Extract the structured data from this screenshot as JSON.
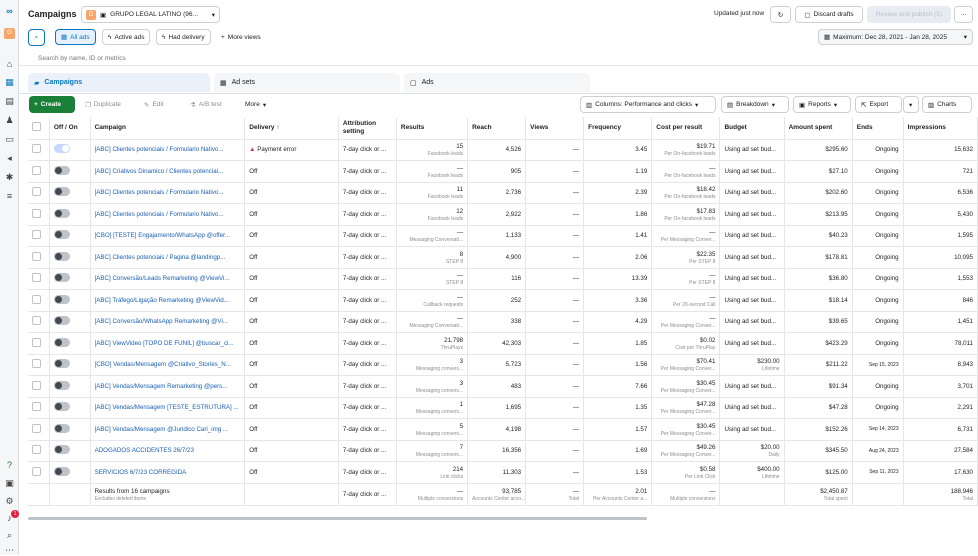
{
  "nav_rail": {
    "icons": [
      "meta-logo-icon",
      "account-avatar-icon",
      "home-icon",
      "table-icon",
      "pages-icon",
      "audiences-icon",
      "billing-icon",
      "megaphone-icon",
      "events-icon",
      "menu-icon",
      "help-icon",
      "notifications-icon",
      "settings-icon",
      "search-icon",
      "more-icon"
    ],
    "notification_badge": "1",
    "avatar_letter": "G"
  },
  "header": {
    "title": "Campaigns",
    "account_name": "GRUPO LEGAL LATINO (96...",
    "account_initial": "G",
    "updated": "Updated just now",
    "discard_label": "Discard drafts",
    "review_label": "Review and publish (5)",
    "more_label": "···"
  },
  "filters": {
    "all_ads": "All ads",
    "active_ads": "Active ads",
    "had_delivery": "Had delivery",
    "more_views": "More views",
    "date_range": "Maximum: Dec 28, 2021 - Jan 28, 2025",
    "search_placeholder": "Search by name, ID or metrics"
  },
  "tabs": {
    "campaigns": "Campaigns",
    "ad_sets": "Ad sets",
    "ads": "Ads"
  },
  "toolbar": {
    "create": "Create",
    "duplicate": "Duplicate",
    "edit": "Edit",
    "ab_test": "A/B test",
    "more": "More",
    "columns": "Columns: Performance and clicks",
    "breakdown": "Breakdown",
    "reports": "Reports",
    "export": "Export",
    "charts": "Charts"
  },
  "columns": {
    "offon": "Off / On",
    "campaign": "Campaign",
    "delivery": "Delivery ↑",
    "attribution": "Attribution setting",
    "results": "Results",
    "reach": "Reach",
    "views": "Views",
    "frequency": "Frequency",
    "cpr": "Cost per result",
    "budget": "Budget",
    "spent": "Amount spent",
    "ends": "Ends",
    "impressions": "Impressions"
  },
  "rows": [
    {
      "name": "[ABC] Clientes potenciais / Formulario Nativo...",
      "delivery": "Payment error",
      "error": true,
      "on": true,
      "attr": "7-day click or ...",
      "res": "15",
      "res_sub": "Facebook leads",
      "reach": "4,526",
      "views": "—",
      "freq": "3.45",
      "cpr": "$19.71",
      "cpr_sub": "Per On-facebook leads",
      "budget": "Using ad set bud...",
      "spent": "$295.60",
      "spent_sub": "",
      "ends": "Ongoing",
      "impr": "15,632"
    },
    {
      "name": "[ABC] Criativos Dinamico / Clientes potenciai...",
      "delivery": "Off",
      "error": false,
      "on": false,
      "attr": "7-day click or ...",
      "res": "—",
      "res_sub": "Facebook leads",
      "reach": "905",
      "views": "—",
      "freq": "1.19",
      "cpr": "—",
      "cpr_sub": "Per On-facebook leads",
      "budget": "Using ad set bud...",
      "spent": "$27.10",
      "spent_sub": "",
      "ends": "Ongoing",
      "impr": "721"
    },
    {
      "name": "[ABC] Clientes potenciais / Formulario Nativo...",
      "delivery": "Off",
      "error": false,
      "on": false,
      "attr": "7-day click or ...",
      "res": "11",
      "res_sub": "Facebook leads",
      "reach": "2,736",
      "views": "—",
      "freq": "2.39",
      "cpr": "$18.42",
      "cpr_sub": "Per On-facebook leads",
      "budget": "Using ad set bud...",
      "spent": "$202.60",
      "spent_sub": "",
      "ends": "Ongoing",
      "impr": "6,536"
    },
    {
      "name": "[ABC] Clientes potenciais / Formulario Nativo...",
      "delivery": "Off",
      "error": false,
      "on": false,
      "attr": "7-day click or ...",
      "res": "12",
      "res_sub": "Facebook leads",
      "reach": "2,922",
      "views": "—",
      "freq": "1.86",
      "cpr": "$17.83",
      "cpr_sub": "Per On-facebook leads",
      "budget": "Using ad set bud...",
      "spent": "$213.95",
      "spent_sub": "",
      "ends": "Ongoing",
      "impr": "5,430"
    },
    {
      "name": "[CBO] [TESTE] Engajamento/WhatsApp @offer...",
      "delivery": "Off",
      "error": false,
      "on": false,
      "attr": "7-day click or ...",
      "res": "—",
      "res_sub": "Messaging Conversati...",
      "reach": "1,133",
      "views": "—",
      "freq": "1.41",
      "cpr": "—",
      "cpr_sub": "Per Messaging Conver...",
      "budget": "Using ad set bud...",
      "spent": "$40.23",
      "spent_sub": "",
      "ends": "Ongoing",
      "impr": "1,595"
    },
    {
      "name": "[ABC] Clientes potenciais / Pagina @landingp...",
      "delivery": "Off",
      "error": false,
      "on": false,
      "attr": "7-day click or ...",
      "res": "8",
      "res_sub": "STEP 8",
      "reach": "4,900",
      "views": "—",
      "freq": "2.06",
      "cpr": "$22.35",
      "cpr_sub": "Per STEP 8",
      "budget": "Using ad set bud...",
      "spent": "$178.81",
      "spent_sub": "",
      "ends": "Ongoing",
      "impr": "10,095"
    },
    {
      "name": "[ABC] Conversão/Leads Remarketing @ViewVi...",
      "delivery": "Off",
      "error": false,
      "on": false,
      "attr": "7-day click or ...",
      "res": "—",
      "res_sub": "STEP 8",
      "reach": "116",
      "views": "—",
      "freq": "13.39",
      "cpr": "—",
      "cpr_sub": "Per STEP 8",
      "budget": "Using ad set bud...",
      "spent": "$36.80",
      "spent_sub": "",
      "ends": "Ongoing",
      "impr": "1,553"
    },
    {
      "name": "[ABC] Tráfego/Ligação Remarketing @ViewVid...",
      "delivery": "Off",
      "error": false,
      "on": false,
      "attr": "7-day click or ...",
      "res": "—",
      "res_sub": "Callback requests",
      "reach": "252",
      "views": "—",
      "freq": "3.36",
      "cpr": "—",
      "cpr_sub": "Per 20-second Call",
      "budget": "Using ad set bud...",
      "spent": "$18.14",
      "spent_sub": "",
      "ends": "Ongoing",
      "impr": "846"
    },
    {
      "name": "[ABC] Conversão/WhatsApp Remarketing @Vi...",
      "delivery": "Off",
      "error": false,
      "on": false,
      "attr": "7-day click or ...",
      "res": "—",
      "res_sub": "Messaging Conversati...",
      "reach": "338",
      "views": "—",
      "freq": "4.29",
      "cpr": "—",
      "cpr_sub": "Per Messaging Conver...",
      "budget": "Using ad set bud...",
      "spent": "$39.65",
      "spent_sub": "",
      "ends": "Ongoing",
      "impr": "1,451"
    },
    {
      "name": "[ABC] ViewVideo [TOPO DE FUNIL] @buscar_ci...",
      "delivery": "Off",
      "error": false,
      "on": false,
      "attr": "7-day click or ...",
      "res": "21,798",
      "res_sub": "ThruPlays",
      "reach": "42,303",
      "views": "—",
      "freq": "1.85",
      "cpr": "$0.02",
      "cpr_sub": "Cost per ThruPlay",
      "budget": "Using ad set bud...",
      "spent": "$423.29",
      "spent_sub": "",
      "ends": "Ongoing",
      "impr": "78,011"
    },
    {
      "name": "[CBO] Vendas/Mensagem @Criativo_Stories_N...",
      "delivery": "Off",
      "error": false,
      "on": false,
      "attr": "7-day click or ...",
      "res": "3",
      "res_sub": "Messaging convers...",
      "reach": "5,723",
      "views": "—",
      "freq": "1.56",
      "cpr": "$70.41",
      "cpr_sub": "Per Messaging Conver...",
      "budget": "$230.00",
      "budget_sub": "Lifetime",
      "spent": "$211.22",
      "spent_sub": "",
      "ends": "Sep 15, 2023",
      "impr": "8,943"
    },
    {
      "name": "[ABC] Vendas/Mensagem Remarketing @pers...",
      "delivery": "Off",
      "error": false,
      "on": false,
      "attr": "7-day click or ...",
      "res": "3",
      "res_sub": "Messaging convers...",
      "reach": "483",
      "views": "—",
      "freq": "7.66",
      "cpr": "$30.45",
      "cpr_sub": "Per Messaging Conver...",
      "budget": "Using ad set bud...",
      "spent": "$91.34",
      "spent_sub": "",
      "ends": "Ongoing",
      "impr": "3,701"
    },
    {
      "name": "[ABC] Vendas/Mensagem [TESTE_ESTRUTURA] ...",
      "delivery": "Off",
      "error": false,
      "on": false,
      "attr": "7-day click or ...",
      "res": "1",
      "res_sub": "Messaging convers...",
      "reach": "1,695",
      "views": "—",
      "freq": "1.35",
      "cpr": "$47.28",
      "cpr_sub": "Per Messaging Conver...",
      "budget": "Using ad set bud...",
      "spent": "$47.28",
      "spent_sub": "",
      "ends": "Ongoing",
      "impr": "2,291"
    },
    {
      "name": "[ABC] Vendas/Mensagem @Juridico Cari_img ...",
      "delivery": "Off",
      "error": false,
      "on": false,
      "attr": "7-day click or ...",
      "res": "5",
      "res_sub": "Messaging convers...",
      "reach": "4,198",
      "views": "—",
      "freq": "1.57",
      "cpr": "$30.45",
      "cpr_sub": "Per Messaging Conver...",
      "budget": "Using ad set bud...",
      "spent": "$152.26",
      "spent_sub": "",
      "ends": "Sep 14, 2023",
      "impr": "6,731"
    },
    {
      "name": "ADOGADOS ACCIDENTES 26/7/23",
      "delivery": "Off",
      "error": false,
      "on": false,
      "attr": "7-day click or ...",
      "res": "7",
      "res_sub": "Messaging convers...",
      "reach": "16,356",
      "views": "—",
      "freq": "1.69",
      "cpr": "$49.26",
      "cpr_sub": "Per Messaging Conver...",
      "budget": "$20.00",
      "budget_sub": "Daily",
      "spent": "$345.50",
      "spent_sub": "",
      "ends": "Aug 24, 2023",
      "impr": "27,584"
    },
    {
      "name": "SERVICIOS 6/7/23 CORREGIDA",
      "delivery": "Off",
      "error": false,
      "on": false,
      "attr": "7-day click or ...",
      "res": "214",
      "res_sub": "Link clicks",
      "reach": "11,303",
      "views": "—",
      "freq": "1.53",
      "cpr": "$0.58",
      "cpr_sub": "Per Link Click",
      "budget": "$400.00",
      "budget_sub": "Lifetime",
      "spent": "$125.00",
      "spent_sub": "",
      "ends": "Sep 11, 2023",
      "impr": "17,630"
    }
  ],
  "totals": {
    "label": "Results from 16 campaigns",
    "sub": "Excludes deleted items",
    "attr": "7-day click or ...",
    "res": "—",
    "res_sub": "Multiple conversions",
    "reach": "93,785",
    "reach_sub": "Accounts Center acco...",
    "views": "—",
    "views_sub": "Total",
    "freq": "2.01",
    "freq_sub": "Per Accounts Center a...",
    "cpr": "—",
    "cpr_sub": "Multiple conversions",
    "spent": "$2,450.87",
    "spent_sub": "Total spent",
    "impr": "188,946",
    "impr_sub": "Total"
  },
  "colors": {
    "accent": "#0a78be",
    "primary_green": "#1a7f37",
    "error": "#e41e3f",
    "link": "#1a5fb4"
  }
}
